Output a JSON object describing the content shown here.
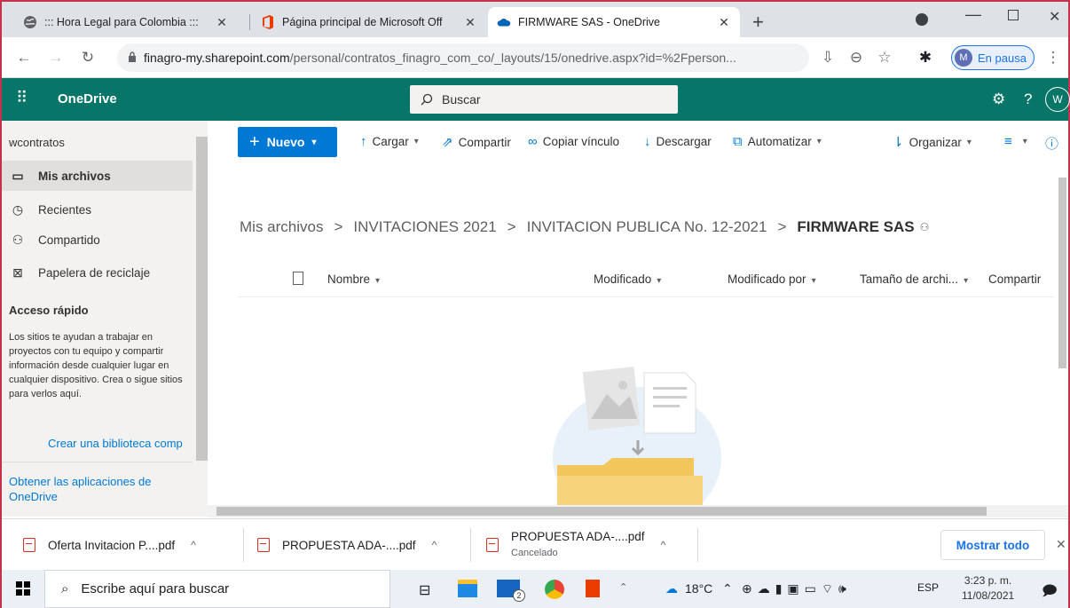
{
  "browser": {
    "tabs": [
      {
        "title": "::: Hora Legal para Colombia :::",
        "icon": "globe-icon",
        "active": false
      },
      {
        "title": "Página principal de Microsoft Off",
        "icon": "office-icon",
        "active": false
      },
      {
        "title": "FIRMWARE SAS - OneDrive",
        "icon": "onedrive-icon",
        "active": true
      }
    ],
    "new_tab": "+",
    "url_host": "finagro-my.sharepoint.com",
    "url_path": "/personal/contratos_finagro_com_co/_layouts/15/onedrive.aspx?id=%2Fperson...",
    "profile_initial": "M",
    "profile_status": "En pausa"
  },
  "suite": {
    "app_name": "OneDrive",
    "search_placeholder": "Buscar",
    "help": "?",
    "user_initial": "W"
  },
  "leftnav": {
    "user": "wcontratos",
    "items": [
      {
        "label": "Mis archivos",
        "icon": "folder-icon",
        "selected": true
      },
      {
        "label": "Recientes",
        "icon": "clock-icon",
        "selected": false
      },
      {
        "label": "Compartido",
        "icon": "people-icon",
        "selected": false
      },
      {
        "label": "Papelera de reciclaje",
        "icon": "recycle-bin-icon",
        "selected": false
      }
    ],
    "quick_access_title": "Acceso rápido",
    "quick_access_desc": "Los sitios te ayudan a trabajar en proyectos con tu equipo y compartir información desde cualquier lugar en cualquier dispositivo. Crea o sigue sitios para verlos aquí.",
    "create_library": "Crear una biblioteca comp",
    "get_apps": "Obtener las aplicaciones de OneDrive"
  },
  "commands": {
    "nuevo": "Nuevo",
    "cargar": "Cargar",
    "compartir": "Compartir",
    "copiar": "Copiar vínculo",
    "descargar": "Descargar",
    "automatizar": "Automatizar",
    "organizar": "Organizar"
  },
  "breadcrumb": [
    "Mis archivos",
    "INVITACIONES 2021",
    "INVITACION PUBLICA No. 12-2021",
    "FIRMWARE SAS"
  ],
  "columns": {
    "nombre": "Nombre",
    "modificado": "Modificado",
    "modificado_por": "Modificado por",
    "tamano": "Tamaño de archi...",
    "compartir": "Compartir"
  },
  "downloads": {
    "items": [
      {
        "name": "Oferta Invitacion P....pdf",
        "status": ""
      },
      {
        "name": "PROPUESTA ADA-....pdf",
        "status": ""
      },
      {
        "name": "PROPUESTA ADA-....pdf",
        "status": "Cancelado"
      }
    ],
    "show_all": "Mostrar todo"
  },
  "taskbar": {
    "search_placeholder": "Escribe aquí para buscar",
    "mail_badge": "2",
    "temperature": "18°C",
    "language": "ESP",
    "time": "3:23 p. m.",
    "date": "11/08/2021"
  },
  "colors": {
    "onedrive_teal": "#077568",
    "accent_blue": "#0078d4",
    "chrome_blue": "#1a73e8"
  }
}
